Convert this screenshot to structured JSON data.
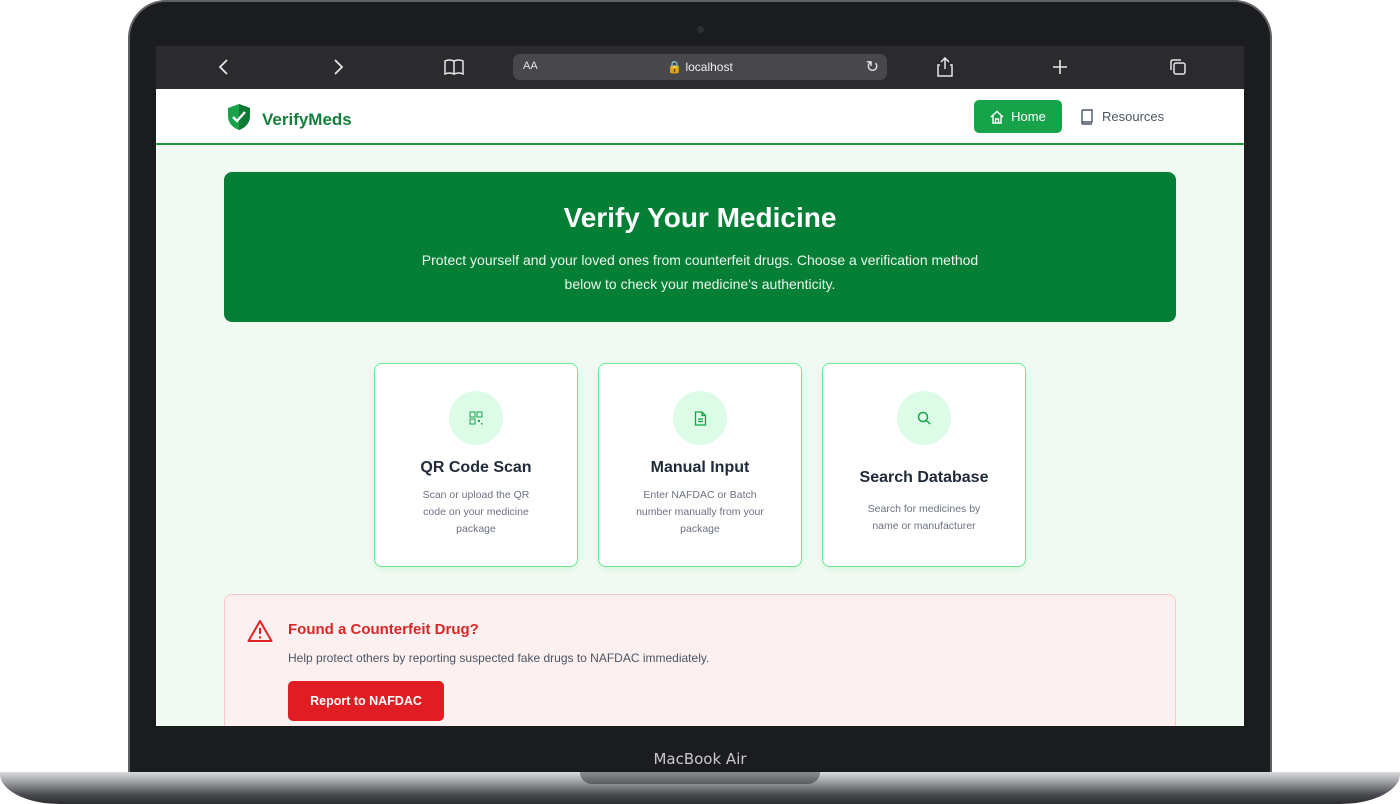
{
  "device": {
    "label": "MacBook Air"
  },
  "browser": {
    "url_host": "localhost",
    "reader_label": "AA",
    "icons": [
      "back-icon",
      "forward-icon",
      "bookmarks-icon",
      "lock-icon",
      "reload-icon",
      "share-icon",
      "new-tab-icon",
      "tabs-icon"
    ]
  },
  "header": {
    "brand": "VerifyMeds",
    "nav": {
      "home": "Home",
      "resources": "Resources"
    }
  },
  "hero": {
    "title": "Verify Your Medicine",
    "subtitle": "Protect yourself and your loved ones from counterfeit drugs. Choose a verification method below to check your medicine's authenticity."
  },
  "methods": [
    {
      "title": "QR Code Scan",
      "description": "Scan or upload the QR code on your medicine package",
      "icon": "qr-code-icon"
    },
    {
      "title": "Manual Input",
      "description": "Enter NAFDAC or Batch number manually from your package",
      "icon": "document-icon"
    },
    {
      "title": "Search Database",
      "description": "Search for medicines by name or manufacturer",
      "icon": "search-icon"
    }
  ],
  "alert": {
    "title": "Found a Counterfeit Drug?",
    "text": "Help protect others by reporting suspected fake drugs to NAFDAC immediately.",
    "button": "Report to NAFDAC"
  },
  "colors": {
    "brand_green": "#057f35",
    "accent_green": "#16a34a",
    "alert_red": "#dc2626",
    "button_red": "#e11d24"
  }
}
